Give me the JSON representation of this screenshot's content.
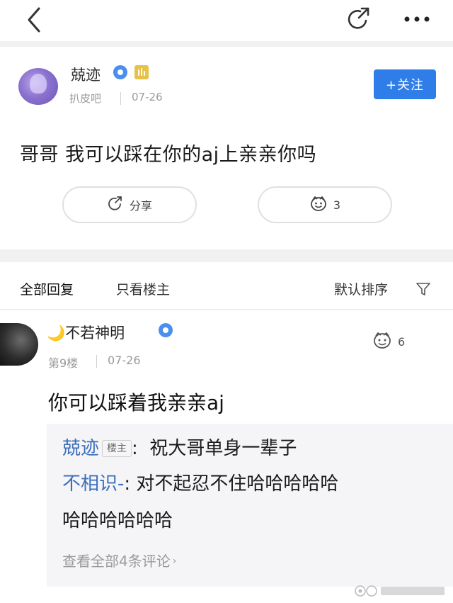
{
  "topbar": {
    "back_icon": "chevron-left-icon",
    "share_icon": "share-arrow-icon",
    "more_icon": "more-dots-icon"
  },
  "post": {
    "author": "兢迹",
    "forum": "扒皮吧",
    "date": "07-26",
    "follow_label": "+关注",
    "text": "哥哥 我可以踩在你的aj上亲亲你吗",
    "share_label": "分享",
    "like_count": "3"
  },
  "tabs": {
    "all": "全部回复",
    "only_owner": "只看楼主",
    "sort": "默认排序"
  },
  "reply": {
    "author": "🌙不若神明",
    "floor": "第9楼",
    "date": "07-26",
    "like_count": "6",
    "text": "你可以踩着我亲亲aj",
    "sub_replies": [
      {
        "name": "兢迹",
        "tag": "楼主",
        "sep": ":",
        "text": "祝大哥单身一辈子"
      },
      {
        "name": "不相识-",
        "sep": ":",
        "text_line1": "对不起忍不住哈哈哈哈哈",
        "text_line2": "哈哈哈哈哈哈"
      }
    ],
    "view_all": "查看全部4条评论"
  },
  "colors": {
    "accent_blue": "#2f7de8",
    "name_blue": "#3c6fba",
    "band_gray": "#f1f1f3"
  }
}
